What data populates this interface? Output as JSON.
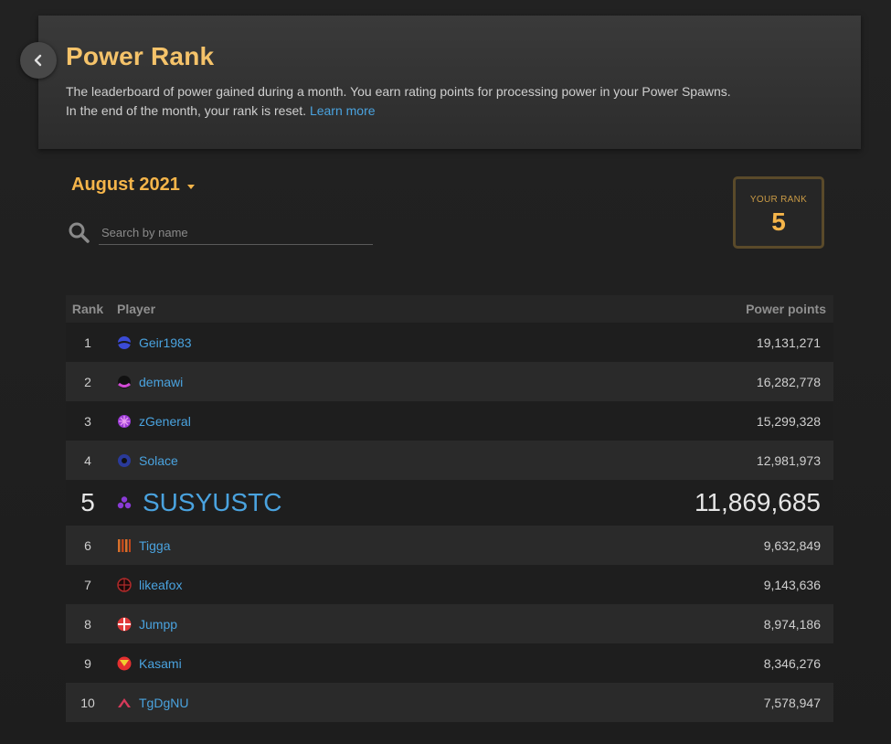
{
  "header": {
    "title": "Power Rank",
    "description_line1": "The leaderboard of power gained during a month. You earn rating points for processing power in your Power Spawns.",
    "description_line2": "In the end of the month, your rank is reset.",
    "learn_more": "Learn more"
  },
  "period": {
    "selected": "August 2021"
  },
  "search": {
    "placeholder": "Search by name"
  },
  "your_rank": {
    "label": "YOUR RANK",
    "value": "5"
  },
  "table": {
    "columns": [
      "Rank",
      "Player",
      "Power points"
    ],
    "rows": [
      {
        "rank": "1",
        "player": "Geir1983",
        "points": "19,131,271",
        "avatar": "globe-avatar",
        "color": "#3b4bd6"
      },
      {
        "rank": "2",
        "player": "demawi",
        "points": "16,282,778",
        "avatar": "smile-avatar",
        "color": "#d24bd6"
      },
      {
        "rank": "3",
        "player": "zGeneral",
        "points": "15,299,328",
        "avatar": "star-avatar",
        "color": "#9b3bd6"
      },
      {
        "rank": "4",
        "player": "Solace",
        "points": "12,981,973",
        "avatar": "ring-avatar",
        "color": "#2a3a9a"
      },
      {
        "rank": "5",
        "player": "SUSYUSTC",
        "points": "11,869,685",
        "avatar": "triangle-avatar",
        "color": "#8a3bd6"
      },
      {
        "rank": "6",
        "player": "Tigga",
        "points": "9,632,849",
        "avatar": "stripes-avatar",
        "color": "#d6702b"
      },
      {
        "rank": "7",
        "player": "likeafox",
        "points": "9,143,636",
        "avatar": "target-avatar",
        "color": "#b02a2a"
      },
      {
        "rank": "8",
        "player": "Jumpp",
        "points": "8,974,186",
        "avatar": "cross-avatar",
        "color": "#e03a3a"
      },
      {
        "rank": "9",
        "player": "Kasami",
        "points": "8,346,276",
        "avatar": "circle-avatar",
        "color": "#e53030"
      },
      {
        "rank": "10",
        "player": "TgDgNU",
        "points": "7,578,947",
        "avatar": "chevron-avatar",
        "color": "#d63a5a"
      }
    ]
  }
}
